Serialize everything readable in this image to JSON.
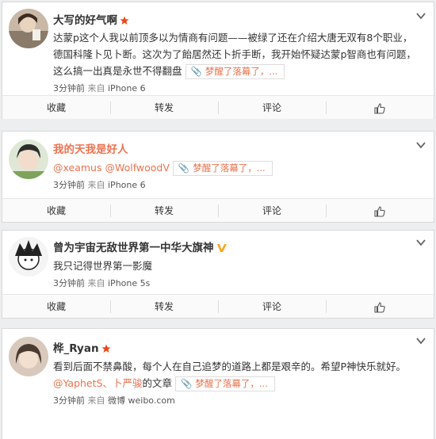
{
  "posts": [
    {
      "name": "大写的好气啊",
      "text_lines": [
        "达蒙p这个人我以前顶多以为情商有问题——被绿了还在介绍大唐无双有8个职业，",
        "德国科隆卜见卜断。这次为了飴居然还卜折手断，我开始怀疑达蒙p智商也有问题，",
        "这么搞一出真是永世不得翻盘"
      ],
      "topic": "梦醒了落幕了，...",
      "time": "3分钟前",
      "from": "来自",
      "device": "iPhone 6"
    },
    {
      "name": "我的天我是好人",
      "mention1": "@xeamus",
      "mention2": "@WolfwoodV",
      "topic": "梦醒了落幕了，...",
      "time": "3分钟前",
      "from": "来自",
      "device": "iPhone 6"
    },
    {
      "name": "曾为宇宙无敌世界第一中华大旗神",
      "text": "我只记得世界第一影魔",
      "time": "3分钟前",
      "from": "来自",
      "device": "iPhone 5s"
    },
    {
      "name": "桦_Ryan",
      "text": "看到后面不禁鼻酸，每个人在自己追梦的道路上都是艰辛的。希望P神快乐就好。",
      "mention1": "@YaphetS、",
      "mention2": "卜严骏",
      "mention_suffix": "的文章",
      "topic": "梦醒了落幕了，...",
      "time": "3分钟前",
      "from": "来自",
      "device": "微博 weibo.com"
    }
  ],
  "actions": {
    "favorite": "收藏",
    "repost": "转发",
    "comment": "评论"
  },
  "colors": {
    "accent": "#eb7350",
    "vip_orange": "#f6a623",
    "badge_red": "#e8491d"
  }
}
